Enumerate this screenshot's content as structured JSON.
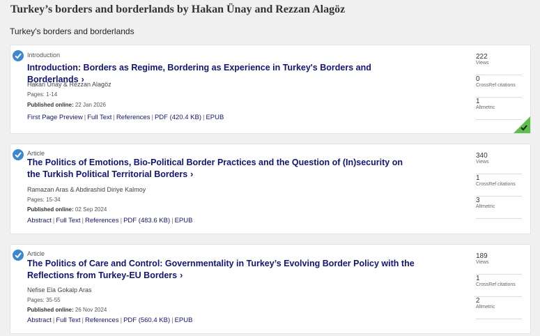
{
  "page_title": "Turkey’s borders and borderlands by Hakan Ünay and Rezzan Alagöz",
  "section_title": "Turkey's borders and borderlands",
  "colors": {
    "accent": "#3b87d6",
    "link": "#10147e",
    "access_badge": "#5cbf4a"
  },
  "articles": [
    {
      "type": "Introduction",
      "title": "Introduction: Borders as Regime, Bordering as Experience in Turkey's Borders and Borderlands",
      "authors": "Hakan Ünay & Rezzan Alagöz",
      "pages": "Pages: 1-14",
      "published_label": "Published online:",
      "published_date": "22 Jan 2026",
      "links": [
        "First Page Preview",
        "Full Text",
        "References",
        "PDF (420.4 KB)",
        "EPUB"
      ],
      "metrics": [
        {
          "value": "222",
          "label": "Views"
        },
        {
          "value": "0",
          "label": "CrossRef citations"
        },
        {
          "value": "1",
          "label": "Altmetric"
        }
      ]
    },
    {
      "type": "Article",
      "title": "The Politics of Emotions, Bio-Political Border Practices and the Question of (In)security on the Turkish Political Territorial Borders",
      "authors": "Ramazan Aras & Abdirashid Diriye Kalmoy",
      "pages": "Pages: 15-34",
      "published_label": "Published online:",
      "published_date": "02 Sep 2024",
      "links": [
        "Abstract",
        "Full Text",
        "References",
        "PDF (483.6 KB)",
        "EPUB"
      ],
      "metrics": [
        {
          "value": "340",
          "label": "Views"
        },
        {
          "value": "1",
          "label": "CrossRef citations"
        },
        {
          "value": "3",
          "label": "Altmetric"
        }
      ]
    },
    {
      "type": "Article",
      "title": "The Politics of Care and Control: Governmentality in Turkey’s Evolving Border Policy with the Reflections from Turkey-EU Borders",
      "authors": "Nefise Ela Gokalp Aras",
      "pages": "Pages: 35-55",
      "published_label": "Published online:",
      "published_date": "26 Nov 2024",
      "links": [
        "Abstract",
        "Full Text",
        "References",
        "PDF (560.4 KB)",
        "EPUB"
      ],
      "metrics": [
        {
          "value": "189",
          "label": "Views"
        },
        {
          "value": "1",
          "label": "CrossRef citations"
        },
        {
          "value": "2",
          "label": "Altmetric"
        }
      ]
    }
  ]
}
